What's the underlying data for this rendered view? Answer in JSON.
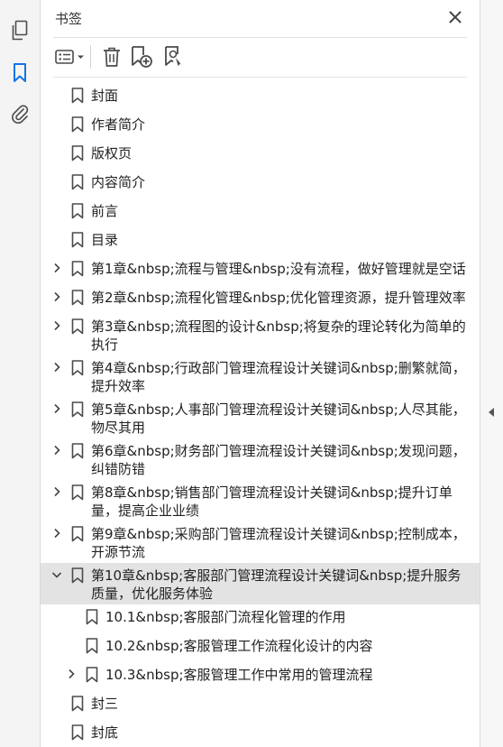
{
  "panel": {
    "title": "书签"
  },
  "toolbar": {
    "options_icon": "options-menu-icon",
    "delete_icon": "trash-icon",
    "new_bookmark_icon": "bookmark-add-icon",
    "bookmark_search_icon": "bookmark-search-icon"
  },
  "bookmarks": [
    {
      "label": "封面",
      "level": 0,
      "expander": "none"
    },
    {
      "label": "作者简介",
      "level": 0,
      "expander": "none"
    },
    {
      "label": "版权页",
      "level": 0,
      "expander": "none"
    },
    {
      "label": "内容简介",
      "level": 0,
      "expander": "none"
    },
    {
      "label": "前言",
      "level": 0,
      "expander": "none"
    },
    {
      "label": "目录",
      "level": 0,
      "expander": "none"
    },
    {
      "label": "第1章&nbsp;流程与管理&nbsp;没有流程，做好管理就是空话",
      "level": 0,
      "expander": "collapsed"
    },
    {
      "label": "第2章&nbsp;流程化管理&nbsp;优化管理资源，提升管理效率",
      "level": 0,
      "expander": "collapsed"
    },
    {
      "label": "第3章&nbsp;流程图的设计&nbsp;将复杂的理论转化为简单的执行",
      "level": 0,
      "expander": "collapsed"
    },
    {
      "label": "第4章&nbsp;行政部门管理流程设计关键词&nbsp;删繁就简，提升效率",
      "level": 0,
      "expander": "collapsed"
    },
    {
      "label": "第5章&nbsp;人事部门管理流程设计关键词&nbsp;人尽其能，物尽其用",
      "level": 0,
      "expander": "collapsed"
    },
    {
      "label": "第6章&nbsp;财务部门管理流程设计关键词&nbsp;发现问题，纠错防错",
      "level": 0,
      "expander": "collapsed"
    },
    {
      "label": "第8章&nbsp;销售部门管理流程设计关键词&nbsp;提升订单量，提高企业业绩",
      "level": 0,
      "expander": "collapsed"
    },
    {
      "label": "第9章&nbsp;采购部门管理流程设计关键词&nbsp;控制成本，开源节流",
      "level": 0,
      "expander": "collapsed"
    },
    {
      "label": "第10章&nbsp;客服部门管理流程设计关键词&nbsp;提升服务质量，优化服务体验",
      "level": 0,
      "expander": "expanded",
      "selected": true
    },
    {
      "label": "10.1&nbsp;客服部门流程化管理的作用",
      "level": 1,
      "expander": "none"
    },
    {
      "label": "10.2&nbsp;客服管理工作流程化设计的内容",
      "level": 1,
      "expander": "none"
    },
    {
      "label": "10.3&nbsp;客服管理工作中常用的管理流程",
      "level": 1,
      "expander": "collapsed"
    },
    {
      "label": "封三",
      "level": 0,
      "expander": "none"
    },
    {
      "label": "封底",
      "level": 0,
      "expander": "none"
    }
  ],
  "navigation": {
    "pages_icon": "page-thumbnails-icon",
    "bookmarks_icon": "bookmark-icon",
    "attachments_icon": "paperclip-icon"
  },
  "colors": {
    "active_nav": "#1473e6",
    "selected_row": "#e3e3e3",
    "icon_gray": "#4b4b4b"
  }
}
